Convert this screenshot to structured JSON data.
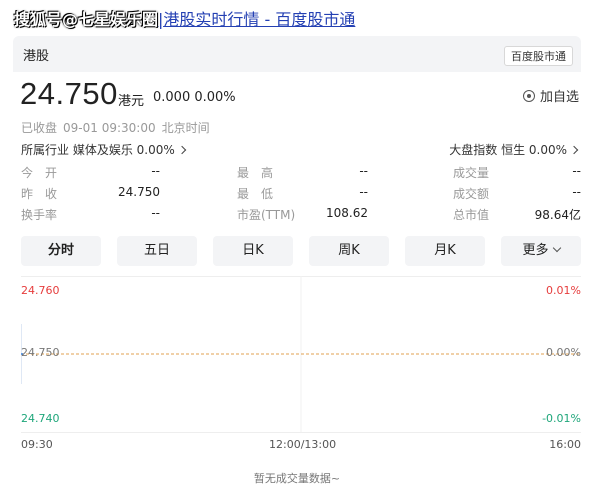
{
  "header": {
    "watermark": "搜狐号@七星娱乐圈",
    "title": "港股实时行情 - 百度股市通"
  },
  "card": {
    "market": "港股",
    "badge": "百度股市通"
  },
  "quote": {
    "price": "24.750",
    "currency": "港元",
    "change": "0.000",
    "change_pct": "0.00%",
    "watch_label": "加自选",
    "status": "已收盘",
    "datetime": "09-01 09:30:00",
    "timezone": "北京时间",
    "industry_label": "所属行业",
    "industry_value": "媒体及娱乐 0.00%",
    "index_label": "大盘指数",
    "index_value": "恒生 0.00%"
  },
  "stats": [
    [
      {
        "label": "今　开",
        "value": "--"
      },
      {
        "label": "最　高",
        "value": "--"
      },
      {
        "label": "成交量",
        "value": "--"
      }
    ],
    [
      {
        "label": "昨　收",
        "value": "24.750"
      },
      {
        "label": "最　低",
        "value": "--"
      },
      {
        "label": "成交额",
        "value": "--"
      }
    ],
    [
      {
        "label": "换手率",
        "value": "--"
      },
      {
        "label": "市盈(TTM)",
        "value": "108.62"
      },
      {
        "label": "总市值",
        "value": "98.64亿"
      }
    ]
  ],
  "tabs": [
    "分时",
    "五日",
    "日K",
    "周K",
    "月K",
    "更多"
  ],
  "active_tab": "分时",
  "chart_data": {
    "type": "line",
    "x_ticks": [
      "09:30",
      "12:00/13:00",
      "16:00"
    ],
    "y_left_ticks": [
      "24.760",
      "24.750",
      "24.740"
    ],
    "y_right_ticks": [
      "0.01%",
      "0.00%",
      "-0.01%"
    ],
    "ylim": [
      24.74,
      24.76
    ],
    "reference_line": 24.75,
    "series": [
      {
        "values": [
          24.75
        ]
      }
    ],
    "colors": {
      "up": "#e63c3c",
      "flat": "#e0a050",
      "down": "#1ea67a",
      "line": "#3c82dc"
    }
  },
  "footer": "暂无成交量数据~"
}
